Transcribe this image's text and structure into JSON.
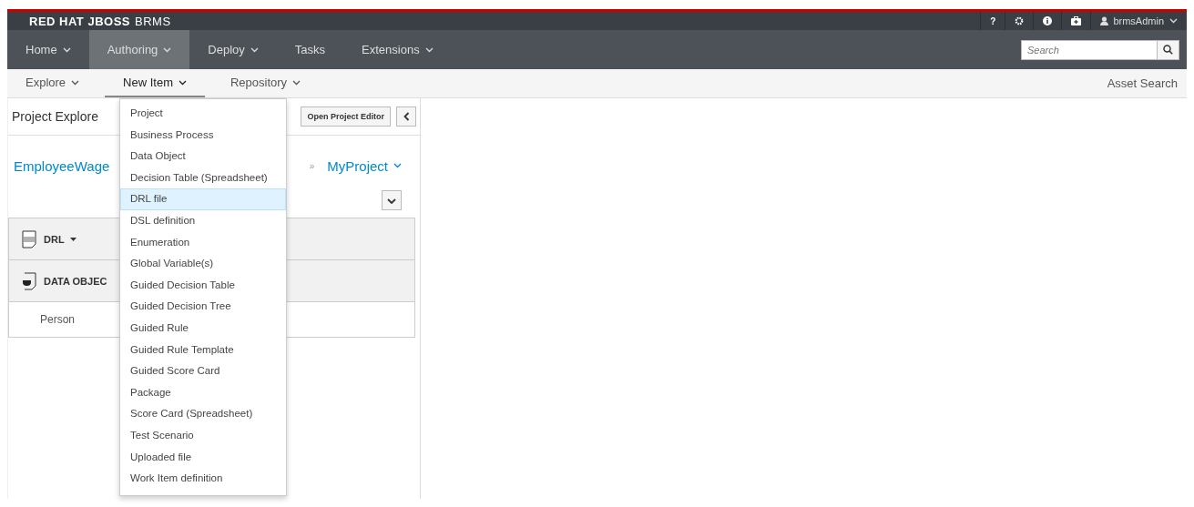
{
  "brand": {
    "name": "RED HAT JBOSS",
    "product": "BRMS"
  },
  "utility": {
    "help": "?",
    "user": "brmsAdmin"
  },
  "nav": [
    {
      "label": "Home",
      "dropdown": true,
      "selected": false
    },
    {
      "label": "Authoring",
      "dropdown": true,
      "selected": true
    },
    {
      "label": "Deploy",
      "dropdown": true,
      "selected": false
    },
    {
      "label": "Tasks",
      "dropdown": false,
      "selected": false
    },
    {
      "label": "Extensions",
      "dropdown": true,
      "selected": false
    }
  ],
  "search": {
    "placeholder": "Search"
  },
  "subnav": [
    {
      "label": "Explore",
      "selected": false
    },
    {
      "label": "New Item",
      "selected": true
    },
    {
      "label": "Repository",
      "selected": false
    }
  ],
  "asset_search": "Asset Search",
  "explorer": {
    "title": "Project Explore",
    "open_editor": "Open Project Editor",
    "breadcrumb": [
      "EmployeeWage",
      "MyProject"
    ],
    "separator": "»",
    "groups": [
      {
        "kind": "drl",
        "label": "DRL",
        "expanded": false
      },
      {
        "kind": "data",
        "label": "DATA OBJEC",
        "expanded": true,
        "items": [
          "Person"
        ]
      }
    ]
  },
  "menu": [
    {
      "label": "Project",
      "selected": false
    },
    {
      "label": "Business Process",
      "selected": false
    },
    {
      "label": "Data Object",
      "selected": false
    },
    {
      "label": "Decision Table (Spreadsheet)",
      "selected": false
    },
    {
      "label": "DRL file",
      "selected": true
    },
    {
      "label": "DSL definition",
      "selected": false
    },
    {
      "label": "Enumeration",
      "selected": false
    },
    {
      "label": "Global Variable(s)",
      "selected": false
    },
    {
      "label": "Guided Decision Table",
      "selected": false
    },
    {
      "label": "Guided Decision Tree",
      "selected": false
    },
    {
      "label": "Guided Rule",
      "selected": false
    },
    {
      "label": "Guided Rule Template",
      "selected": false
    },
    {
      "label": "Guided Score Card",
      "selected": false
    },
    {
      "label": "Package",
      "selected": false
    },
    {
      "label": "Score Card (Spreadsheet)",
      "selected": false
    },
    {
      "label": "Test Scenario",
      "selected": false
    },
    {
      "label": "Uploaded file",
      "selected": false
    },
    {
      "label": "Work Item definition",
      "selected": false
    }
  ]
}
